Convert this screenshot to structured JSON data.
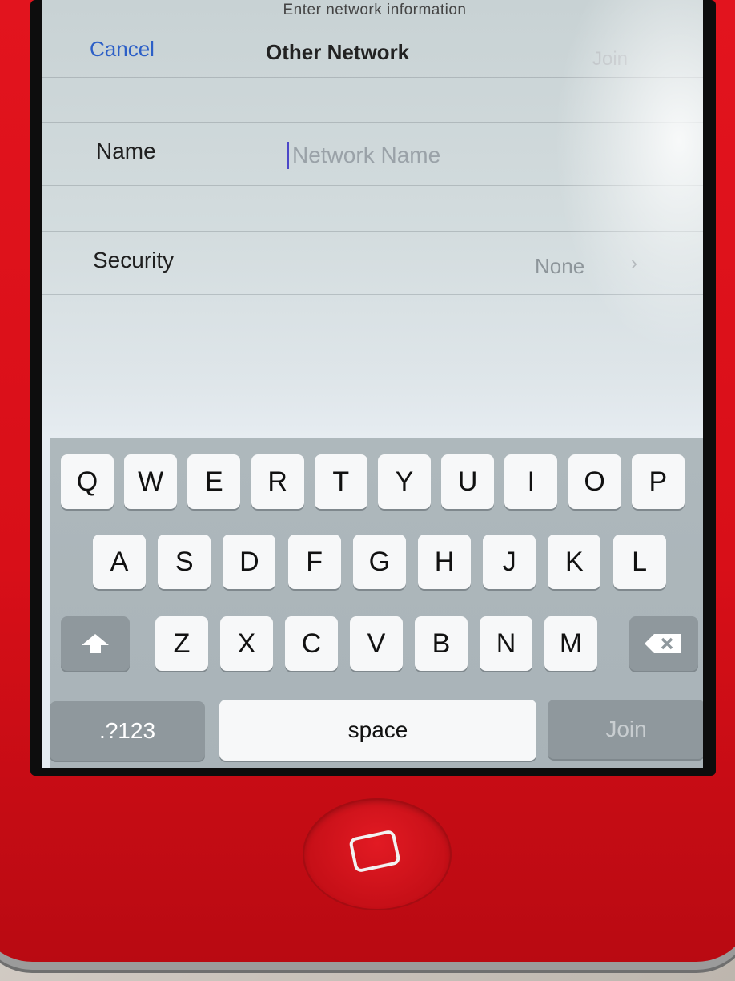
{
  "nav": {
    "prompt": "Enter network information",
    "cancel_label": "Cancel",
    "title": "Other Network",
    "join_label": "Join"
  },
  "form": {
    "name_label": "Name",
    "name_placeholder": "Network Name",
    "security_label": "Security",
    "security_value": "None",
    "security_chevron": "›"
  },
  "keyboard": {
    "row1": [
      "Q",
      "W",
      "E",
      "R",
      "T",
      "Y",
      "U",
      "I",
      "O",
      "P"
    ],
    "row2": [
      "A",
      "S",
      "D",
      "F",
      "G",
      "H",
      "J",
      "K",
      "L"
    ],
    "row3": [
      "Z",
      "X",
      "C",
      "V",
      "B",
      "N",
      "M"
    ],
    "numbers_label": ".?123",
    "space_label": "space",
    "join_label": "Join"
  },
  "colors": {
    "phone_body": "#d80f18",
    "link_blue": "#2c5fc7",
    "keyboard_bg": "#aeb8bc"
  }
}
